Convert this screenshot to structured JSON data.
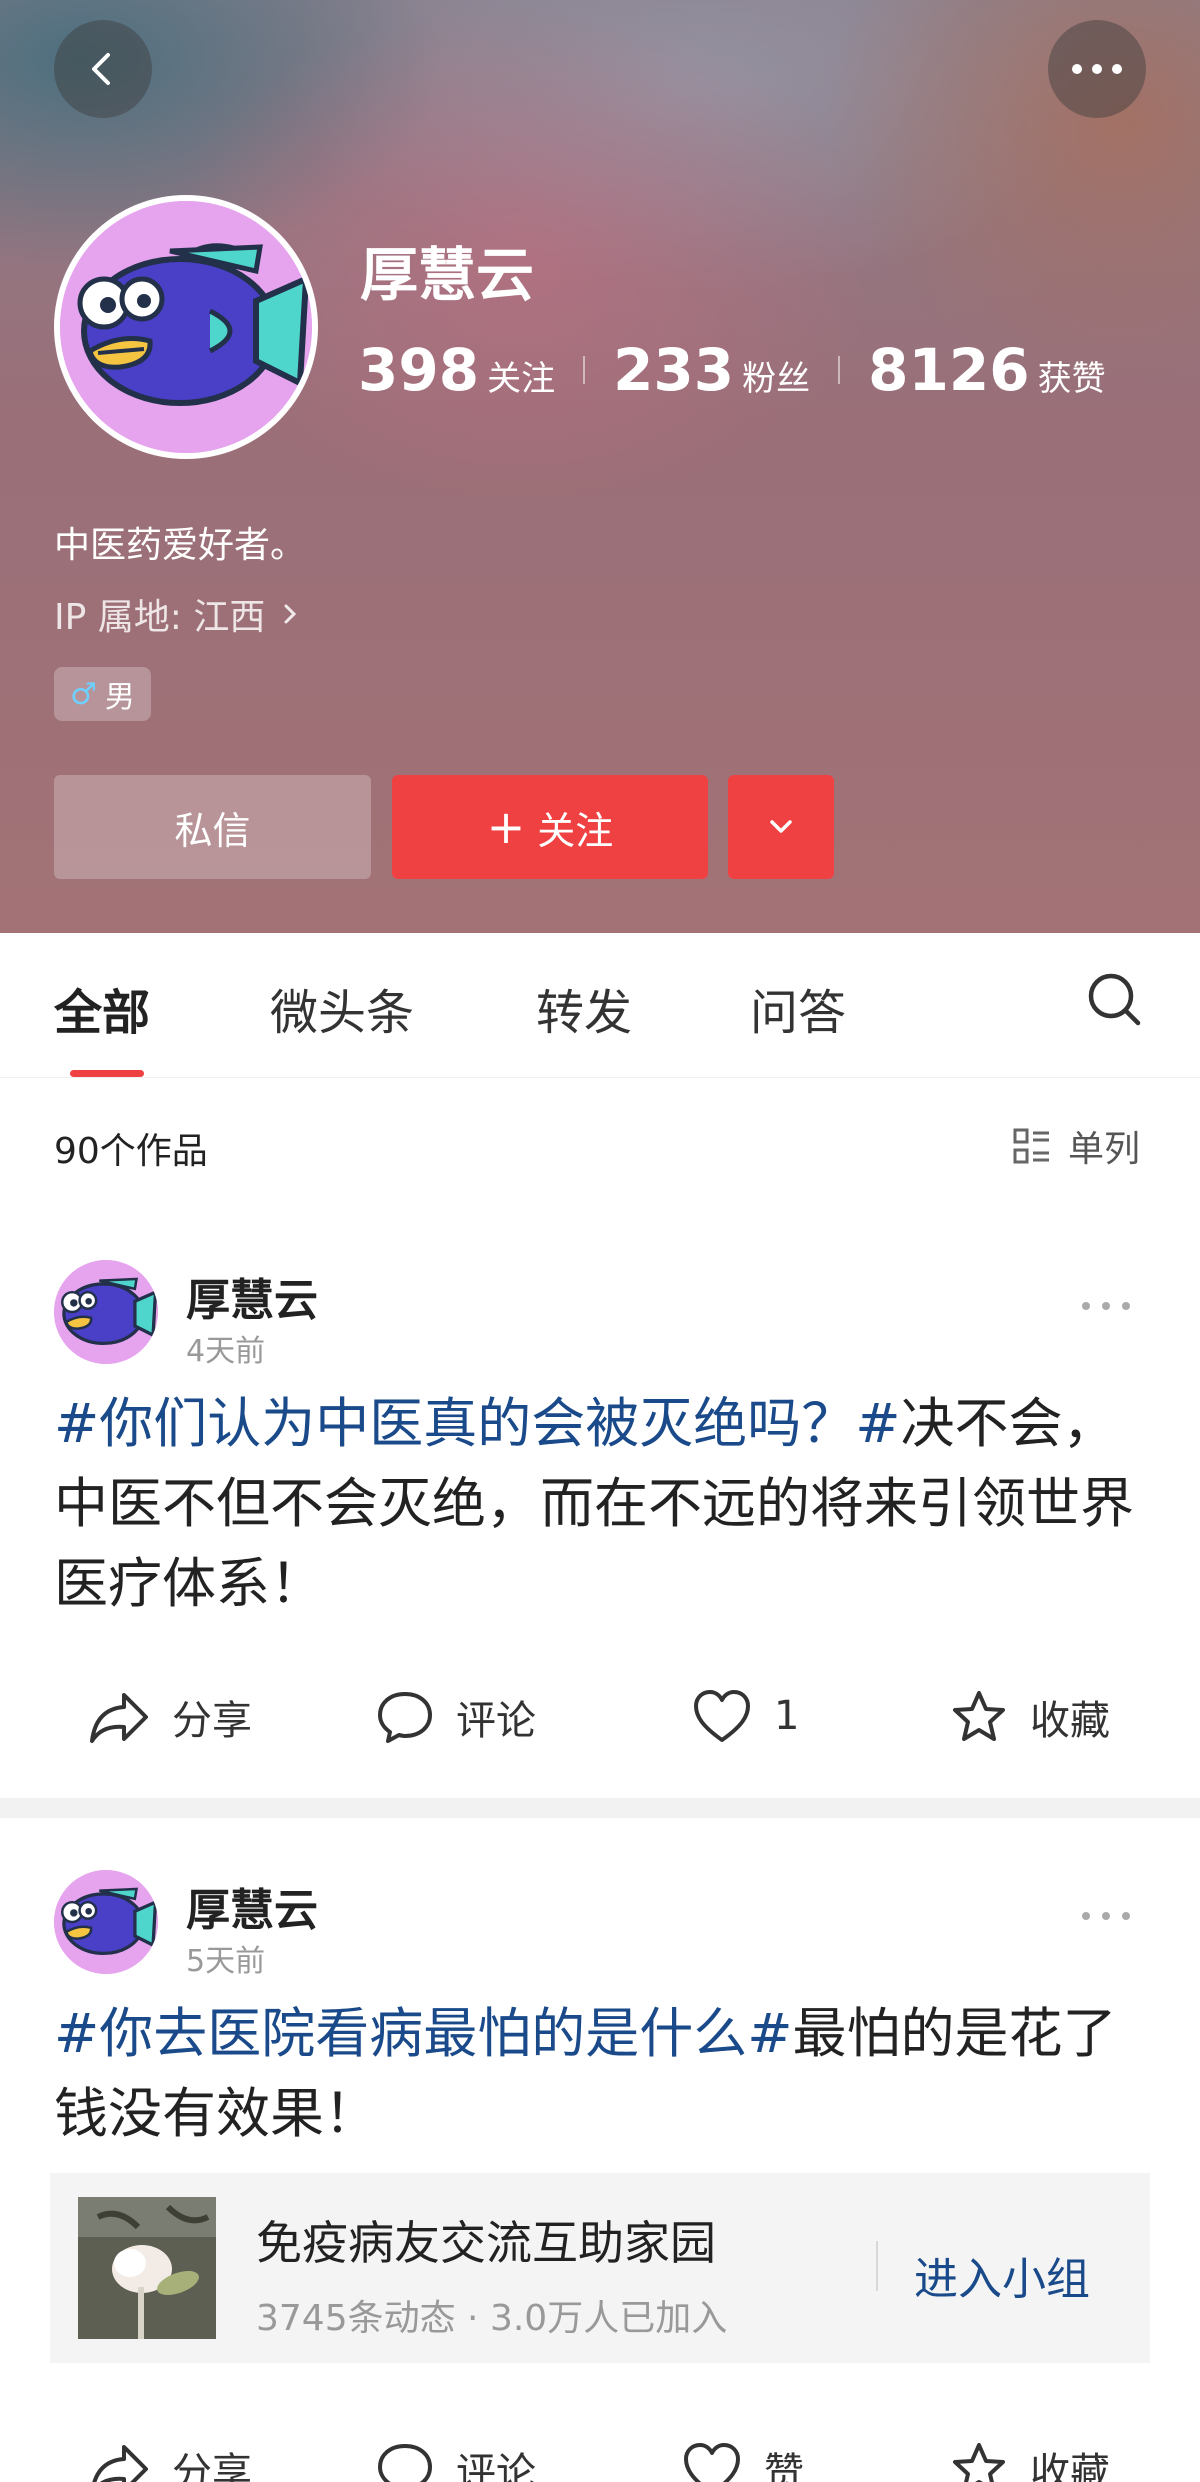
{
  "colors": {
    "accent": "#f04142",
    "hashtag": "#1a4a8a",
    "muted": "#999999"
  },
  "profile": {
    "name": "厚慧云",
    "stats": [
      {
        "value": "398",
        "label": "关注"
      },
      {
        "value": "233",
        "label": "粉丝"
      },
      {
        "value": "8126",
        "label": "获赞"
      }
    ],
    "bio": "中医药爱好者。",
    "ip": "IP 属地: 江西",
    "gender_symbol": "♂",
    "gender": "男",
    "message_label": "私信",
    "follow_plus": "+",
    "follow_label": "关注"
  },
  "tabs": [
    {
      "label": "全部",
      "active": true
    },
    {
      "label": "微头条",
      "active": false
    },
    {
      "label": "转发",
      "active": false
    },
    {
      "label": "问答",
      "active": false
    }
  ],
  "works": {
    "count_label": "90个作品",
    "layout_label": "单列"
  },
  "posts": [
    {
      "author": "厚慧云",
      "time": "4天前",
      "hashtag": "#你们认为中医真的会被灭绝吗？#",
      "text": "决不会，中医不但不会灭绝，而在不远的将来引领世界医疗体系！",
      "actions": {
        "share": "分享",
        "comment": "评论",
        "like": "1",
        "favorite": "收藏"
      }
    },
    {
      "author": "厚慧云",
      "time": "5天前",
      "hashtag": "#你去医院看病最怕的是什么#",
      "text": "最怕的是花了钱没有效果！",
      "group": {
        "name": "免疫病友交流互助家园",
        "meta": "3745条动态 · 3.0万人已加入",
        "join_label": "进入小组"
      },
      "actions": {
        "share": "分享",
        "comment": "评论",
        "like": "赞",
        "favorite": "收藏"
      }
    }
  ],
  "icons": {
    "back": "chevron-left-icon",
    "more": "more-horizontal-icon",
    "search": "search-icon",
    "share": "share-arrow-icon",
    "comment": "comment-bubble-icon",
    "like": "heart-icon",
    "favorite": "star-icon"
  }
}
